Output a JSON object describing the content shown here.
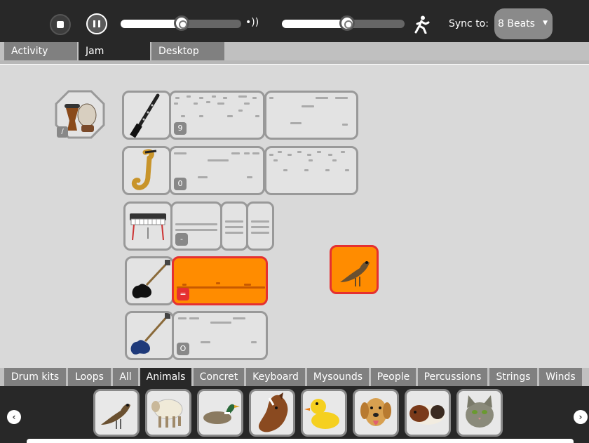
{
  "toolbar": {
    "sync_label": "Sync to:",
    "sync_value": "8 Beats",
    "volume_level": 0.5,
    "tempo_level": 0.53
  },
  "tabs": [
    {
      "label": "Activity",
      "active": false
    },
    {
      "label": "Jam",
      "active": true
    },
    {
      "label": "Desktop",
      "active": false
    }
  ],
  "drum": {
    "label": "/"
  },
  "tracks": [
    {
      "instrument": "clarinet",
      "loops": [
        {
          "label": "9"
        },
        {
          "label": ""
        }
      ]
    },
    {
      "instrument": "saxophone",
      "loops": [
        {
          "label": "0"
        },
        {
          "label": ""
        }
      ]
    },
    {
      "instrument": "keyboard",
      "loops": [
        {
          "label": "-"
        },
        {
          "label": ""
        },
        {
          "label": ""
        }
      ]
    },
    {
      "instrument": "electric-guitar",
      "loops": [
        {
          "label": "="
        }
      ]
    },
    {
      "instrument": "bass-guitar",
      "loops": [
        {
          "label": "O"
        }
      ]
    }
  ],
  "categories": [
    {
      "label": "Drum kits",
      "active": false
    },
    {
      "label": "Loops",
      "active": false
    },
    {
      "label": "All",
      "active": false
    },
    {
      "label": "Animals",
      "active": true
    },
    {
      "label": "Concret",
      "active": false
    },
    {
      "label": "Keyboard",
      "active": false
    },
    {
      "label": "Mysounds",
      "active": false
    },
    {
      "label": "People",
      "active": false
    },
    {
      "label": "Percussions",
      "active": false
    },
    {
      "label": "Strings",
      "active": false
    },
    {
      "label": "Winds",
      "active": false
    }
  ],
  "palette": [
    "bird",
    "sheep",
    "duck",
    "horse",
    "rubber-duck",
    "dog",
    "guinea-pig",
    "cat"
  ],
  "colors": {
    "toolbar": "#282828",
    "selected_fill": "#ff8c00",
    "selected_border": "#e53030",
    "tile_border": "#999999"
  }
}
